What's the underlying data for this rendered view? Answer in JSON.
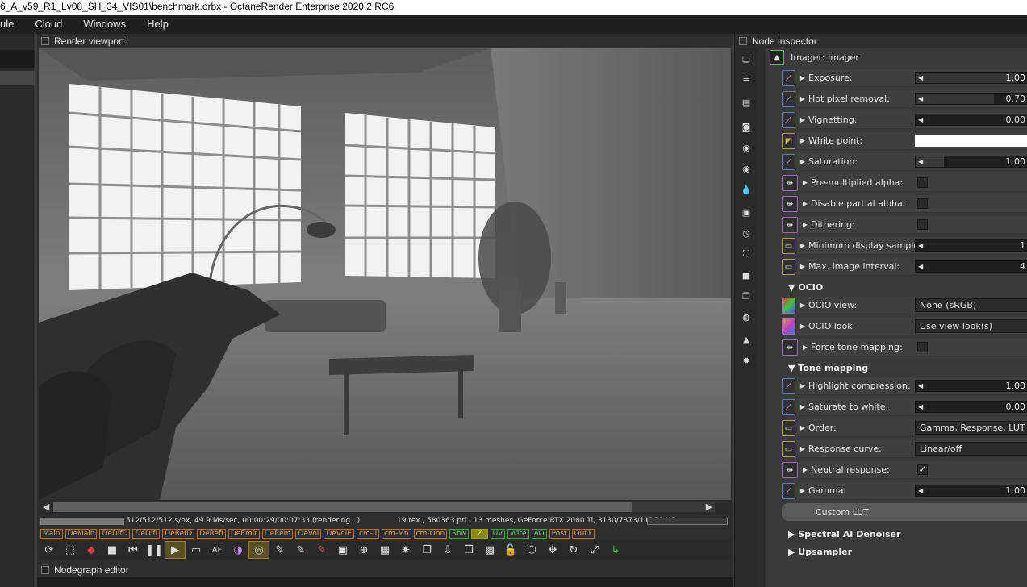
{
  "window": {
    "title": "6_A_v59_R1_Lv08_SH_34_VIS01\\benchmark.orbx - OctaneRender Enterprise 2020.2 RC6"
  },
  "menu": [
    "ule",
    "Cloud",
    "Windows",
    "Help"
  ],
  "viewport": {
    "title": "Render viewport",
    "status_left": "512/512/512 s/px, 49.9 Ms/sec, 00:00:29/00:07:33 (rendering...)",
    "status_right": "19 tex., 580363 pri., 13 meshes, GeForce RTX 2080 Ti, 3130/7873/11264 MB",
    "progress": 1.0,
    "passes": [
      "Main",
      "DeMain",
      "DeDifD",
      "DeDifI",
      "DeRefD",
      "DeRefI",
      "DeEmit",
      "DeRem",
      "DeVol",
      "DeVolE",
      "cm-Ii",
      "cm-Mn",
      "cm-Onn",
      "ShN",
      "Z",
      "UV",
      "Wire",
      "AO",
      "Post",
      "Out1"
    ]
  },
  "nodegraph": {
    "title": "Nodegraph editor"
  },
  "inspector": {
    "title": "Node inspector",
    "node_title": "Imager: Imager",
    "params": [
      {
        "label": "Exposure:",
        "type": "slider",
        "value": "1.00",
        "fill": 0.9,
        "icon": "curve-icon"
      },
      {
        "label": "Hot pixel removal:",
        "type": "slider",
        "value": "0.70",
        "fill": 0.7,
        "icon": "curve-icon"
      },
      {
        "label": "Vignetting:",
        "type": "slider",
        "value": "0.00",
        "fill": 0.0,
        "icon": "curve-icon"
      },
      {
        "label": "White point:",
        "type": "color",
        "value": "#ffffff",
        "icon": "color-icon"
      },
      {
        "label": "Saturation:",
        "type": "slider",
        "value": "1.00",
        "fill": 0.25,
        "icon": "curve-icon"
      },
      {
        "label": "Pre-multiplied alpha:",
        "type": "check",
        "checked": false,
        "icon": "bool-icon"
      },
      {
        "label": "Disable partial alpha:",
        "type": "check",
        "checked": false,
        "icon": "bool-icon"
      },
      {
        "label": "Dithering:",
        "type": "check",
        "checked": false,
        "icon": "bool-icon"
      },
      {
        "label": "Minimum display samples:",
        "type": "slider",
        "value": "1",
        "fill": 0.0,
        "icon": "int-icon"
      },
      {
        "label": "Max. image interval:",
        "type": "slider",
        "value": "4",
        "fill": 0.0,
        "icon": "int-icon"
      }
    ],
    "ocio_section": "OCIO",
    "ocio_params": [
      {
        "label": "OCIO view:",
        "value": "None (sRGB)"
      },
      {
        "label": "OCIO look:",
        "value": "Use view look(s)"
      },
      {
        "label": "Force tone mapping:",
        "checked": false
      }
    ],
    "tone_section": "Tone mapping",
    "tone_params": [
      {
        "label": "Highlight compression:",
        "type": "slider",
        "value": "1.00"
      },
      {
        "label": "Saturate to white:",
        "type": "slider",
        "value": "0.00"
      },
      {
        "label": "Order:",
        "type": "dropdown",
        "value": "Gamma, Response, LUT"
      },
      {
        "label": "Response curve:",
        "type": "dropdown",
        "value": "Linear/off"
      },
      {
        "label": "Neutral response:",
        "type": "check",
        "checked": true
      },
      {
        "label": "Gamma:",
        "type": "slider",
        "value": "1.00"
      }
    ],
    "custom_lut": "Custom LUT",
    "spectral_section": "Spectral AI Denoiser",
    "upsampler_section": "Upsampler"
  }
}
